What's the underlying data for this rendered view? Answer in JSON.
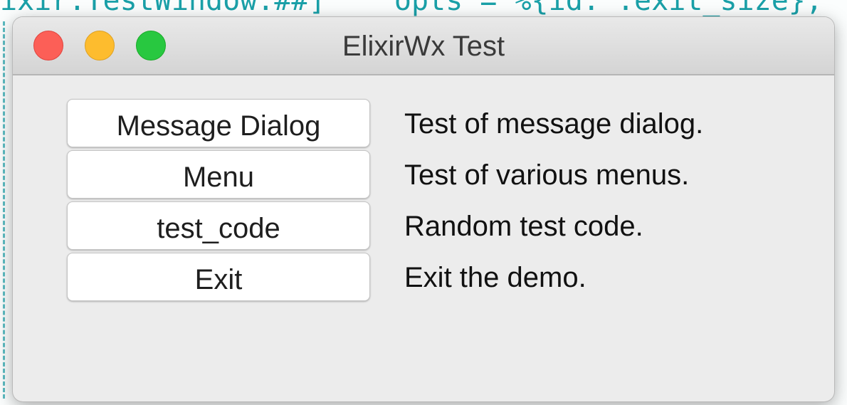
{
  "window": {
    "title": "ElixirWx Test"
  },
  "buttons": [
    {
      "label": "Message Dialog",
      "description": "Test of message dialog."
    },
    {
      "label": "Menu",
      "description": "Test of various menus."
    },
    {
      "label": "test_code",
      "description": "Random test code."
    },
    {
      "label": "Exit",
      "description": "Exit the demo."
    }
  ],
  "background_code": {
    "top_line": "ixir.TestWindow.##]    opts = %{id: :exit_size},"
  },
  "colors": {
    "close": "#fc5f57",
    "minimize": "#fdbc2e",
    "maximize": "#28c840",
    "code_text": "#1aa0a8"
  }
}
